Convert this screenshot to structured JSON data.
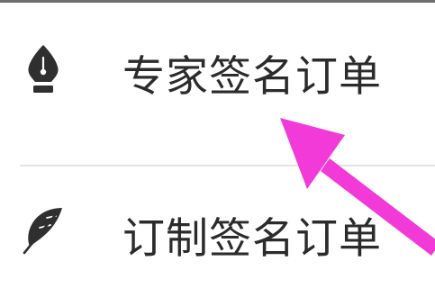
{
  "menu": {
    "items": [
      {
        "label": "专家签名订单",
        "icon": "fountain-pen-nib-icon"
      },
      {
        "label": "订制签名订单",
        "icon": "feather-quill-icon"
      }
    ]
  },
  "annotation": {
    "arrow_color": "#f23ad8"
  },
  "colors": {
    "label_text": "#2b2b2b",
    "icon": "#2f2f2f",
    "divider": "#e4e4e4",
    "top_bar": "#6f6f6f",
    "background": "#ffffff"
  }
}
